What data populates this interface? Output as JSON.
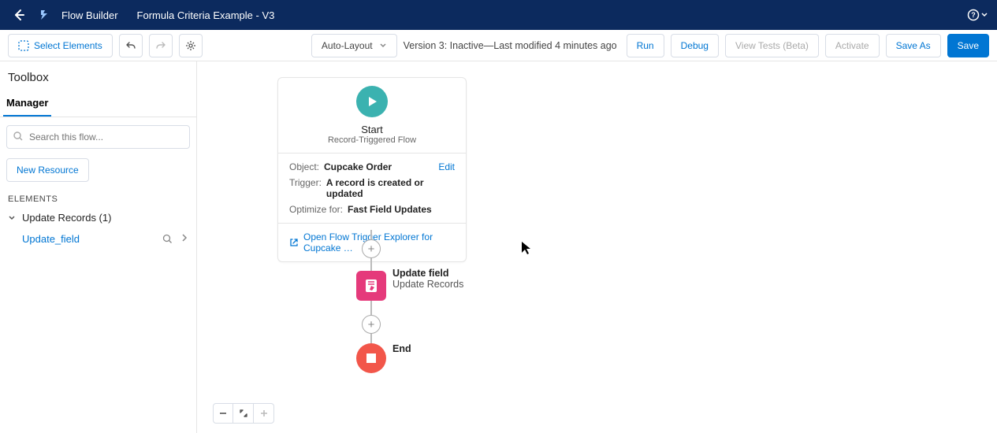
{
  "header": {
    "app_name": "Flow Builder",
    "flow_name": "Formula Criteria Example - V3"
  },
  "toolbar": {
    "select_elements": "Select Elements",
    "auto_layout": "Auto-Layout",
    "version_text": "Version 3: Inactive—Last modified 4 minutes ago",
    "run": "Run",
    "debug": "Debug",
    "view_tests": "View Tests (Beta)",
    "activate": "Activate",
    "save_as": "Save As",
    "save": "Save"
  },
  "sidebar": {
    "toolbox": "Toolbox",
    "manager_tab": "Manager",
    "search_placeholder": "Search this flow...",
    "new_resource": "New Resource",
    "elements_label": "ELEMENTS",
    "group_label": "Update Records (1)",
    "item_label": "Update_field"
  },
  "canvas": {
    "start": {
      "title": "Start",
      "subtitle": "Record-Triggered Flow",
      "object_label": "Object:",
      "object_value": "Cupcake Order",
      "trigger_label": "Trigger:",
      "trigger_value": "A record is created or updated",
      "optimize_label": "Optimize for:",
      "optimize_value": "Fast Field Updates",
      "edit": "Edit",
      "explorer_link": "Open Flow Trigger Explorer for Cupcake …"
    },
    "update_node": {
      "title": "Update field",
      "subtitle": "Update Records"
    },
    "end": {
      "title": "End"
    }
  }
}
